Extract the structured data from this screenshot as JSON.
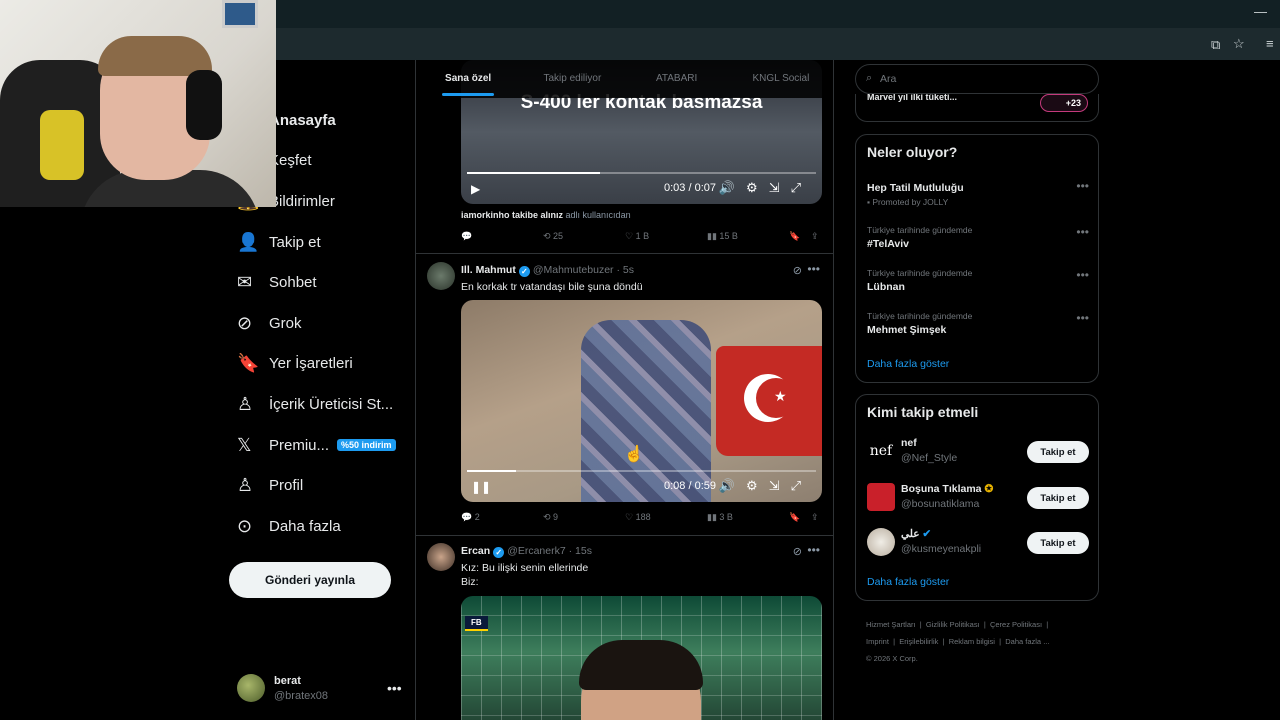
{
  "browser": {
    "icons": [
      "minimize-icon",
      "install-icon",
      "star-icon",
      "menu-icon"
    ]
  },
  "sidebar": {
    "items": [
      {
        "label": "Anasayfa",
        "icon": "home-icon",
        "glyph": "⌂"
      },
      {
        "label": "Keşfet",
        "icon": "search-icon",
        "glyph": "⌕"
      },
      {
        "label": "Bildirimler",
        "icon": "bell-icon",
        "glyph": "🔔"
      },
      {
        "label": "Takip et",
        "icon": "add-person-icon",
        "glyph": "👤"
      },
      {
        "label": "Sohbet",
        "icon": "mail-icon",
        "glyph": "✉"
      },
      {
        "label": "Grok",
        "icon": "grok-icon",
        "glyph": "⊘"
      },
      {
        "label": "Yer İşaretleri",
        "icon": "bookmark-icon",
        "glyph": "🔖"
      },
      {
        "label": "İçerik Üreticisi St...",
        "icon": "creator-studio-icon",
        "glyph": "♙"
      },
      {
        "label": "Premiu...",
        "icon": "x-logo-icon",
        "glyph": "𝕏",
        "badge": "%50 indirim"
      },
      {
        "label": "Profil",
        "icon": "profile-icon",
        "glyph": "♙"
      },
      {
        "label": "Daha fazla",
        "icon": "more-circle-icon",
        "glyph": "⊙"
      }
    ],
    "post_button": "Gönderi yayınla",
    "user": {
      "name": "berat",
      "handle": "@bratex08"
    }
  },
  "feed": {
    "tabs": [
      "Sana özel",
      "Takip ediliyor",
      "ATABARI",
      "KNGL Social"
    ],
    "post1": {
      "video_caption": "S-400 ler kontak basmazsa",
      "video_time": "0:03 / 0:07",
      "progress": 0.38,
      "disclaimer_bold": "iamorkinho takibe alınız",
      "disclaimer_rest": " adlı kullanıcıdan",
      "replies": "",
      "reposts": "25",
      "likes": "1 B",
      "views": "15 B"
    },
    "post2": {
      "name": "Ill. Mahmut",
      "handle": "@Mahmutebuzer · 5s",
      "text": "En korkak tr vatandaşı bile şuna döndü",
      "video_time": "0:08 / 0:59",
      "progress": 0.14,
      "replies": "2",
      "reposts": "9",
      "likes": "188",
      "views": "3 B"
    },
    "post3": {
      "name": "Ercan",
      "handle": "@Ercanerk7 · 15s",
      "text1": "Kız: Bu ilişki senin ellerinde",
      "text2": "Biz:",
      "overlay": "FB"
    }
  },
  "right": {
    "search_placeholder": "Ara",
    "top_item": "Marvel yıl ilki tüketi...",
    "top_badge": "+23",
    "trends_title": "Neler oluyor?",
    "trends": [
      {
        "small": "",
        "big": "Hep Tatil Mutluluğu",
        "promoted": "Promoted by JOLLY"
      },
      {
        "small": "Türkiye tarihinde gündemde",
        "big": "#TelAviv"
      },
      {
        "small": "Türkiye tarihinde gündemde",
        "big": "Lübnan"
      },
      {
        "small": "Türkiye tarihinde gündemde",
        "big": "Mehmet Şimşek"
      }
    ],
    "trends_more": "Daha fazla göster",
    "follow_title": "Kimi takip etmeli",
    "follows": [
      {
        "name": "nef",
        "handle": "@Nef_Style",
        "button": "Takip et"
      },
      {
        "name": "Boşuna Tıklama",
        "handle": "@bosunatiklama",
        "button": "Takip et"
      },
      {
        "name": "علي",
        "handle": "@kusmeyenakpli",
        "button": "Takip et"
      }
    ],
    "follow_more": "Daha fazla göster",
    "footer": [
      "Hizmet Şartları",
      "Gizlilik Politikası",
      "Çerez Politikası",
      "Imprint",
      "Erişilebilirlik",
      "Reklam bilgisi",
      "Daha fazla ...",
      "© 2026 X Corp."
    ]
  }
}
